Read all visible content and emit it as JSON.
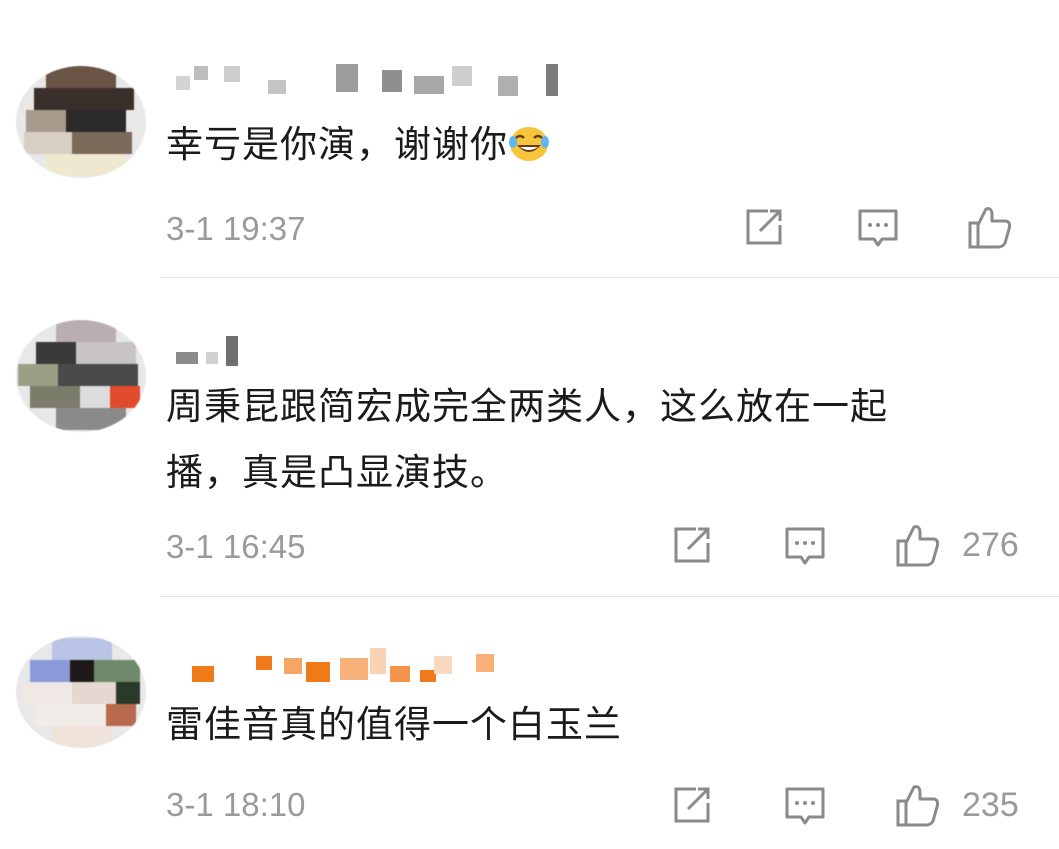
{
  "comments": [
    {
      "text": "幸亏是你演，谢谢你",
      "emoji": "laughing-crying-emoji",
      "time": "3-1 19:37",
      "likes": ""
    },
    {
      "text_line1": "周秉昆跟简宏成完全两类人，这么放在一起",
      "text_line2": "播，真是凸显演技。",
      "time": "3-1 16:45",
      "likes": "276"
    },
    {
      "text": "雷佳音真的值得一个白玉兰",
      "time": "3-1 18:10",
      "likes": "235"
    }
  ],
  "icons": {
    "share": "share-icon",
    "reply": "comment-icon",
    "like": "thumbs-up-icon"
  },
  "colors": {
    "text": "#1b1b1b",
    "meta": "#9a9a9a",
    "divider": "#e4e4e4",
    "vip_orange": "#f07a1a"
  }
}
